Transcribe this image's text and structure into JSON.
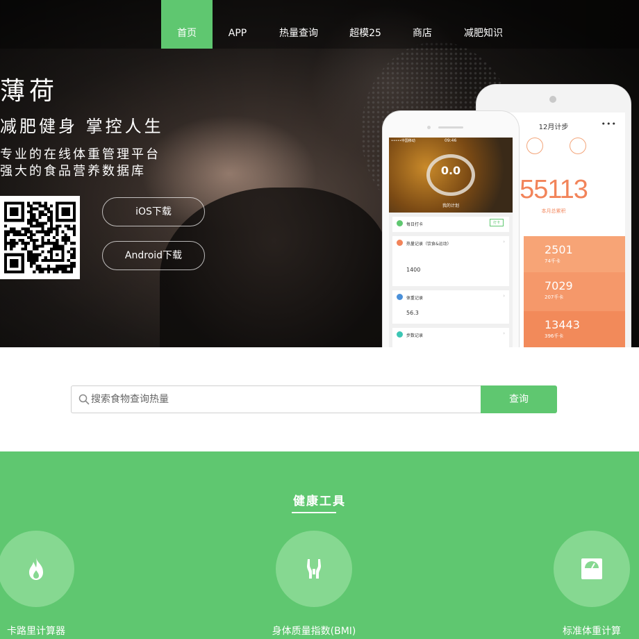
{
  "nav": {
    "items": [
      "首页",
      "APP",
      "热量查询",
      "超模25",
      "商店",
      "减肥知识"
    ],
    "active_index": 0
  },
  "hero": {
    "brand": "薄荷",
    "slogan": "减肥健身 掌控人生",
    "line1": "专业的在线体重管理平台",
    "line2": "强大的食品营养数据库",
    "ios_button": "iOS下载",
    "android_button": "Android下载"
  },
  "phone_back": {
    "title": "12月计步",
    "menu": "•••",
    "total": "55113",
    "total_label": "本月总累积",
    "bands": [
      {
        "value": "2501",
        "unit": "74千卡"
      },
      {
        "value": "7029",
        "unit": "207千卡"
      },
      {
        "value": "13443",
        "unit": "396千卡"
      }
    ]
  },
  "phone_front": {
    "carrier": "•••••中国移动",
    "time": "09:46",
    "ring_value": "0.0",
    "plan_label": "我的计划",
    "cards": [
      {
        "title": "每日打卡",
        "action": "打卡"
      },
      {
        "title": "热量记录（饮食&运动）",
        "value": "1400"
      },
      {
        "title": "体重记录",
        "value": "56.3"
      },
      {
        "title": "步数记录"
      }
    ]
  },
  "search": {
    "placeholder": "搜索食物查询热量",
    "button": "查询"
  },
  "tools": {
    "title": "健康工具",
    "items": [
      {
        "label": "卡路里计算器",
        "icon": "flame-icon"
      },
      {
        "label": "身体质量指数(BMI)",
        "icon": "body-icon"
      },
      {
        "label": "标准体重计算",
        "icon": "scale-icon"
      }
    ]
  },
  "colors": {
    "brand_green": "#5fc770",
    "tool_circle": "#86d891",
    "accent_orange": "#f2845a"
  }
}
